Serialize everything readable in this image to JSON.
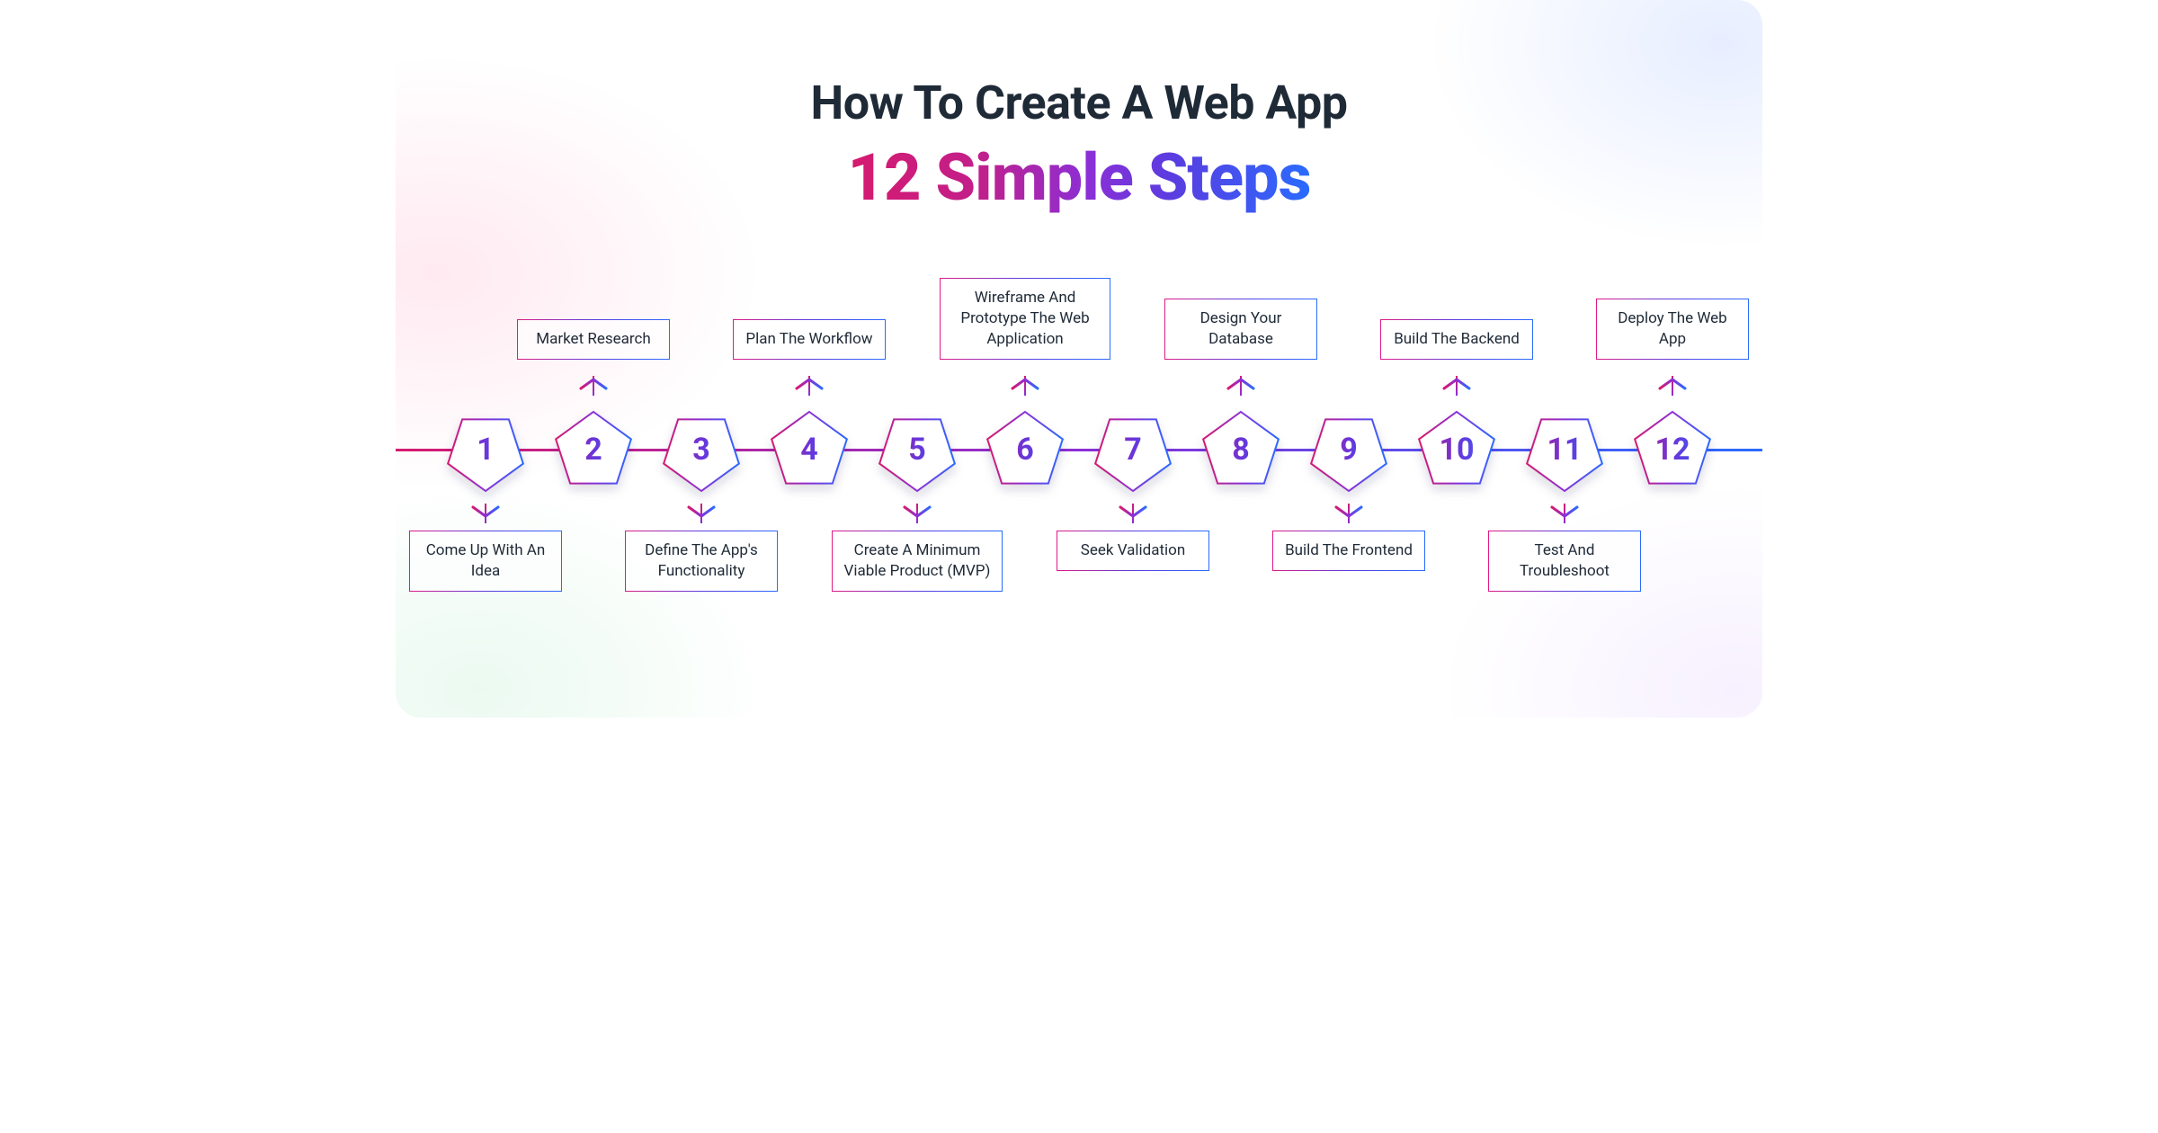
{
  "title": {
    "line1": "How To Create A Web App",
    "line2": "12 Simple Steps"
  },
  "colors": {
    "gradient_start": "#d61a6f",
    "gradient_mid": "#8b2fd6",
    "gradient_end": "#2a6bff",
    "text": "#1f2a37"
  },
  "steps": [
    {
      "n": "1",
      "label": "Come Up With An Idea",
      "side": "bottom"
    },
    {
      "n": "2",
      "label": "Market Research",
      "side": "top"
    },
    {
      "n": "3",
      "label": "Define The App's Functionality",
      "side": "bottom"
    },
    {
      "n": "4",
      "label": "Plan The Workflow",
      "side": "top"
    },
    {
      "n": "5",
      "label": "Create A Minimum Viable Product (MVP)",
      "side": "bottom"
    },
    {
      "n": "6",
      "label": "Wireframe And Prototype The Web Application",
      "side": "top"
    },
    {
      "n": "7",
      "label": "Seek Validation",
      "side": "bottom"
    },
    {
      "n": "8",
      "label": "Design Your Database",
      "side": "top"
    },
    {
      "n": "9",
      "label": "Build The Frontend",
      "side": "bottom"
    },
    {
      "n": "10",
      "label": "Build The Backend",
      "side": "top"
    },
    {
      "n": "11",
      "label": "Test And Troubleshoot",
      "side": "bottom"
    },
    {
      "n": "12",
      "label": "Deploy The Web App",
      "side": "top"
    }
  ]
}
